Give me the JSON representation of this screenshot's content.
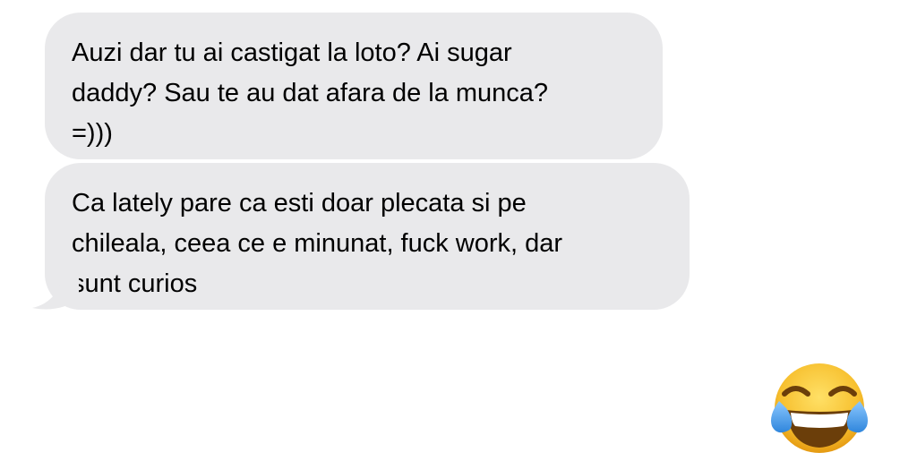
{
  "messages": [
    {
      "sender": "incoming",
      "text": "Auzi dar tu ai castigat la loto? Ai sugar\ndaddy? Sau te au dat afara de la munca?\n=)))"
    },
    {
      "sender": "incoming",
      "text": "Ca lately pare ca esti doar plecata si pe\nchileala, ceea ce e minunat, fuck work, dar\nsunt curios"
    }
  ],
  "reaction": {
    "icon": "face-with-tears-of-joy-icon"
  },
  "colors": {
    "bubble_incoming": "#e9e9eb",
    "text": "#000000",
    "background": "#ffffff",
    "emoji_face": "#f7c02f",
    "emoji_tears": "#4a9ee8"
  }
}
